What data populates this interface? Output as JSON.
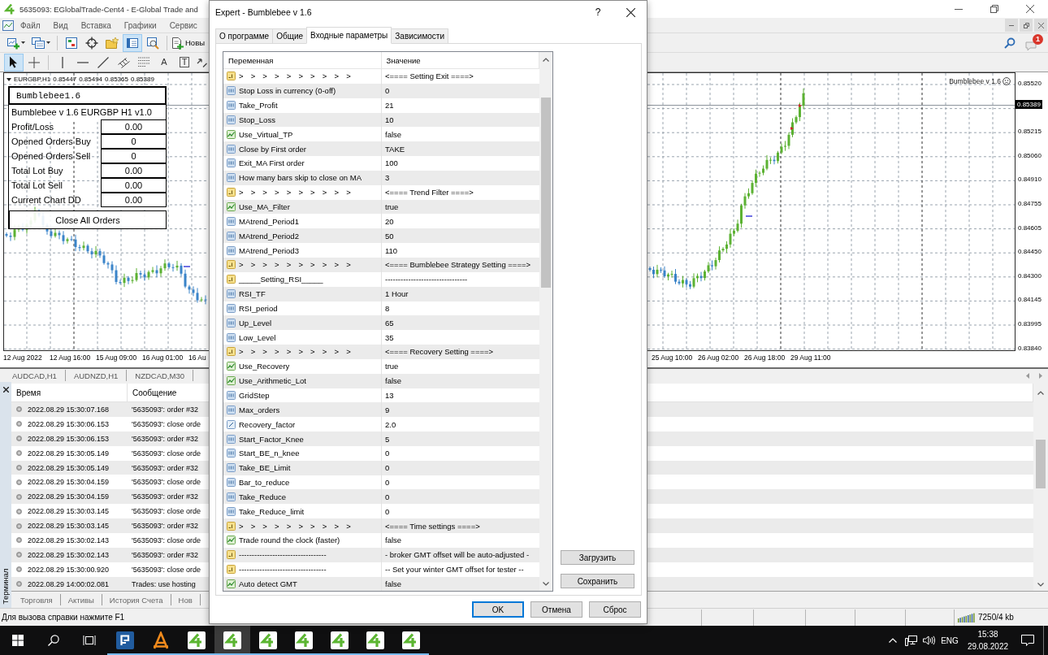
{
  "main_window": {
    "title": "5635093: EGlobalTrade-Cent4 - E-Global Trade and"
  },
  "menu": [
    "Файл",
    "Вид",
    "Вставка",
    "Графики",
    "Сервис"
  ],
  "toolbar": {
    "tools": [
      {
        "kind": "new-chart",
        "selected": false
      },
      {
        "kind": "profiles",
        "selected": false
      },
      {
        "kind": "market-watch",
        "selected": false
      },
      {
        "kind": "data-window",
        "selected": false
      },
      {
        "kind": "navigator",
        "selected": false
      },
      {
        "kind": "terminal",
        "selected": true
      },
      {
        "kind": "tester",
        "selected": false
      }
    ],
    "new_order": "Новы",
    "notifications": "1"
  },
  "drawing_tools": [
    {
      "kind": "cursor",
      "selected": true
    },
    {
      "kind": "crosshair",
      "selected": false
    },
    {
      "kind": "vertical-line",
      "selected": false
    },
    {
      "kind": "horizontal-line",
      "selected": false
    },
    {
      "kind": "trend-line",
      "selected": false
    },
    {
      "kind": "channel",
      "selected": false
    },
    {
      "kind": "fibonacci",
      "selected": false
    },
    {
      "kind": "text",
      "glyph": "A",
      "selected": false
    },
    {
      "kind": "label",
      "glyph": "T",
      "selected": false
    },
    {
      "kind": "arrows",
      "selected": false
    }
  ],
  "chart": {
    "symbol": "EURGBP,H1",
    "ohlc": [
      "0.85447",
      "0.85494",
      "0.85365",
      "0.85389"
    ],
    "expert": "Bumblebee v 1.6",
    "current_price": "0.85389",
    "price_labels": [
      "0.85520",
      "0.85215",
      "0.85060",
      "0.84910",
      "0.84755",
      "0.84605",
      "0.84450",
      "0.84300",
      "0.84145",
      "0.83995",
      "0.83840"
    ],
    "time_labels_left": [
      "12 Aug 2022",
      "12 Aug 16:00",
      "15 Aug 09:00",
      "16 Aug 01:00",
      "16 Au"
    ],
    "time_labels_right": [
      "25 Aug 10:00",
      "26 Aug 02:00",
      "26 Aug 18:00",
      "29 Aug 11:00"
    ]
  },
  "info_panel": {
    "title": "Bumblebee1.6",
    "subtitle": "Bumblebee v 1.6 EURGBP H1 v1.0",
    "rows": [
      {
        "label": "Profit/Loss",
        "value": "0.00"
      },
      {
        "label": "Opened Orders Buy",
        "value": "0"
      },
      {
        "label": "Opened Orders Sell",
        "value": "0"
      },
      {
        "label": "Total Lot Buy",
        "value": "0.00"
      },
      {
        "label": "Total Lot Sell",
        "value": "0.00"
      },
      {
        "label": "Current Chart DD",
        "value": "0.00"
      }
    ],
    "button": "Close All Orders"
  },
  "chart_tabs": [
    {
      "label": "AUDCAD,H1",
      "selected": false
    },
    {
      "label": "AUDNZD,H1",
      "selected": false
    },
    {
      "label": "NZDCAD,M30",
      "selected": false
    }
  ],
  "terminal": {
    "title": "Терминал",
    "columns": [
      "Время",
      "Сообщение"
    ],
    "rows": [
      {
        "time": "2022.08.29 15:30:07.168",
        "message": "'5635093': order #32"
      },
      {
        "time": "2022.08.29 15:30:06.153",
        "message": "'5635093': close orde"
      },
      {
        "time": "2022.08.29 15:30:06.153",
        "message": "'5635093': order #32"
      },
      {
        "time": "2022.08.29 15:30:05.149",
        "message": "'5635093': close orde"
      },
      {
        "time": "2022.08.29 15:30:05.149",
        "message": "'5635093': order #32"
      },
      {
        "time": "2022.08.29 15:30:04.159",
        "message": "'5635093': close orde"
      },
      {
        "time": "2022.08.29 15:30:04.159",
        "message": "'5635093': order #32"
      },
      {
        "time": "2022.08.29 15:30:03.145",
        "message": "'5635093': close orde"
      },
      {
        "time": "2022.08.29 15:30:03.145",
        "message": "'5635093': order #32"
      },
      {
        "time": "2022.08.29 15:30:02.143",
        "message": "'5635093': close orde"
      },
      {
        "time": "2022.08.29 15:30:02.143",
        "message": "'5635093': order #32"
      },
      {
        "time": "2022.08.29 15:30:00.920",
        "message": "'5635093': close orde"
      },
      {
        "time": "2022.08.29 14:00:02.081",
        "message": "Trades: use hosting"
      }
    ],
    "tabs": [
      {
        "label": "Торговля",
        "selected": false
      },
      {
        "label": "Активы",
        "selected": false
      },
      {
        "label": "История Счета",
        "selected": false
      },
      {
        "label": "Нов",
        "selected": false
      }
    ]
  },
  "status_bar": {
    "help": "Для вызова справки нажмите F1",
    "traffic": "7250/4 kb"
  },
  "taskbar": {
    "apps": [
      {
        "kind": "tile-p",
        "selected": false,
        "running": true
      },
      {
        "kind": "triangle-a",
        "selected": false,
        "running": true
      },
      {
        "kind": "terminal-4",
        "selected": false,
        "running": true
      },
      {
        "kind": "terminal-4",
        "selected": true,
        "running": true
      },
      {
        "kind": "terminal-4",
        "selected": false,
        "running": true
      },
      {
        "kind": "terminal-4",
        "selected": false,
        "running": true
      },
      {
        "kind": "terminal-4",
        "selected": false,
        "running": true
      },
      {
        "kind": "terminal-4",
        "selected": false,
        "running": true
      },
      {
        "kind": "terminal-4",
        "selected": false,
        "running": true
      }
    ],
    "language": "ENG",
    "time": "15:38",
    "date": "29.08.2022"
  },
  "dialog": {
    "title": "Expert - Bumblebee v 1.6",
    "help": "?",
    "tabs": [
      {
        "label": "О программе",
        "selected": false
      },
      {
        "label": "Общие",
        "selected": false
      },
      {
        "label": "Входные параметры",
        "selected": true
      },
      {
        "label": "Зависимости",
        "selected": false
      }
    ],
    "columns": [
      "Переменная",
      "Значение"
    ],
    "params": [
      {
        "kind": "group",
        "name": "> > > > > > > > > >",
        "value": "<==== Setting Exit ====>"
      },
      {
        "kind": "int",
        "name": "Stop Loss in currency (0-off)",
        "value": "0"
      },
      {
        "kind": "int",
        "name": "Take_Profit",
        "value": "21"
      },
      {
        "kind": "int",
        "name": "Stop_Loss",
        "value": "10"
      },
      {
        "kind": "bool",
        "name": "Use_Virtual_TP",
        "value": "false"
      },
      {
        "kind": "int",
        "name": "Close by First order",
        "value": "TAKE"
      },
      {
        "kind": "int",
        "name": "Exit_MA First order",
        "value": "100"
      },
      {
        "kind": "int",
        "name": "How many bars skip to close on MA",
        "value": "3"
      },
      {
        "kind": "group",
        "name": "> > > > > > > > > >",
        "value": "<==== Trend Filter ====>"
      },
      {
        "kind": "bool",
        "name": "Use_MA_Filter",
        "value": "true"
      },
      {
        "kind": "int",
        "name": "MAtrend_Period1",
        "value": "20"
      },
      {
        "kind": "int",
        "name": "MAtrend_Period2",
        "value": "50"
      },
      {
        "kind": "int",
        "name": "MAtrend_Period3",
        "value": "110"
      },
      {
        "kind": "group",
        "name": "> > > > > > > > > >",
        "value": "<==== Bumblebee Strategy Setting ====>"
      },
      {
        "kind": "string",
        "name": "_____Setting_RSI_____",
        "value": "--------------------------------"
      },
      {
        "kind": "int",
        "name": "RSI_TF",
        "value": "1 Hour"
      },
      {
        "kind": "int",
        "name": "RSI_period",
        "value": "8"
      },
      {
        "kind": "int",
        "name": "Up_Level",
        "value": "65"
      },
      {
        "kind": "int",
        "name": "Low_Level",
        "value": "35"
      },
      {
        "kind": "group",
        "name": "> > > > > > > > > >",
        "value": "<==== Recovery Setting ====>"
      },
      {
        "kind": "bool",
        "name": "Use_Recovery",
        "value": "true"
      },
      {
        "kind": "bool",
        "name": "Use_Arithmetic_Lot",
        "value": "false"
      },
      {
        "kind": "int",
        "name": "GridStep",
        "value": "13"
      },
      {
        "kind": "int",
        "name": "Max_orders",
        "value": "9"
      },
      {
        "kind": "double",
        "name": "Recovery_factor",
        "value": "2.0"
      },
      {
        "kind": "int",
        "name": "Start_Factor_Knee",
        "value": "5"
      },
      {
        "kind": "int",
        "name": "Start_BE_n_knee",
        "value": "0"
      },
      {
        "kind": "int",
        "name": "Take_BE_Limit",
        "value": "0"
      },
      {
        "kind": "int",
        "name": "Bar_to_reduce",
        "value": "0"
      },
      {
        "kind": "int",
        "name": "Take_Reduce",
        "value": "0"
      },
      {
        "kind": "int",
        "name": "Take_Reduce_limit",
        "value": "0"
      },
      {
        "kind": "group",
        "name": "> > > > > > > > > >",
        "value": "<==== Time settings ====>"
      },
      {
        "kind": "bool",
        "name": "Trade round the clock (faster)",
        "value": "false"
      },
      {
        "kind": "string",
        "name": "----------------------------------",
        "value": "- broker GMT offset will be auto-adjusted -"
      },
      {
        "kind": "string",
        "name": "----------------------------------",
        "value": "-- Set your winter GMT offset for tester --"
      },
      {
        "kind": "bool",
        "name": "Auto detect GMT",
        "value": "false"
      }
    ],
    "side_buttons": [
      "Загрузить",
      "Сохранить"
    ],
    "buttons": [
      {
        "label": "OK",
        "default": true
      },
      {
        "label": "Отмена",
        "default": false
      },
      {
        "label": "Сброс",
        "default": false
      }
    ]
  }
}
